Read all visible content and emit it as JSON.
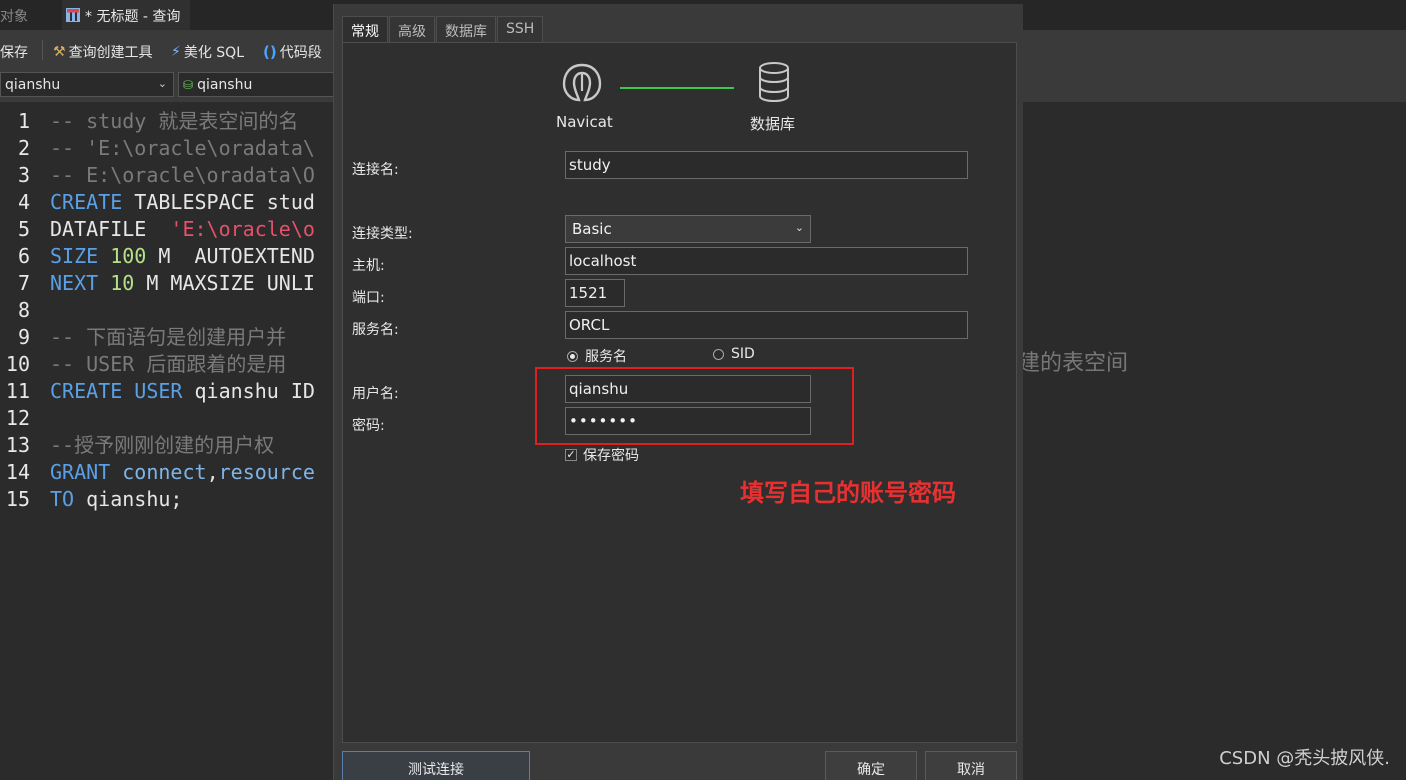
{
  "tabs": {
    "objects": "对象",
    "query": "* 无标题 - 查询"
  },
  "toolbar": {
    "save": "保存",
    "builder": "查询创建工具",
    "beautify": "美化 SQL",
    "snippet": "代码段"
  },
  "selectors": {
    "connection": "qianshu",
    "schema": "qianshu"
  },
  "code": {
    "lines": [
      {
        "n": "1",
        "parts": [
          {
            "c": "cm",
            "t": "-- study 就是表空间的名"
          }
        ]
      },
      {
        "n": "2",
        "parts": [
          {
            "c": "cm",
            "t": "-- 'E:\\oracle\\oradata\\"
          }
        ]
      },
      {
        "n": "3",
        "parts": [
          {
            "c": "cm",
            "t": "-- E:\\oracle\\oradata\\O"
          }
        ]
      },
      {
        "n": "4",
        "parts": [
          {
            "c": "kw",
            "t": "CREATE"
          },
          {
            "c": "pl",
            "t": " TABLESPACE stud"
          }
        ]
      },
      {
        "n": "5",
        "parts": [
          {
            "c": "pl",
            "t": "DATAFILE  "
          },
          {
            "c": "str",
            "t": "'E:\\oracle\\o"
          }
        ]
      },
      {
        "n": "6",
        "parts": [
          {
            "c": "kw",
            "t": "SIZE"
          },
          {
            "c": "pl",
            "t": " "
          },
          {
            "c": "num",
            "t": "100"
          },
          {
            "c": "pl",
            "t": " M  AUTOEXTEND"
          }
        ]
      },
      {
        "n": "7",
        "parts": [
          {
            "c": "kw",
            "t": "NEXT"
          },
          {
            "c": "pl",
            "t": " "
          },
          {
            "c": "num",
            "t": "10"
          },
          {
            "c": "pl",
            "t": " M MAXSIZE UNLI"
          }
        ]
      },
      {
        "n": "8",
        "parts": []
      },
      {
        "n": "9",
        "parts": [
          {
            "c": "cm",
            "t": "-- 下面语句是创建用户并"
          }
        ]
      },
      {
        "n": "10",
        "parts": [
          {
            "c": "cm",
            "t": "-- USER 后面跟着的是用"
          }
        ]
      },
      {
        "n": "11",
        "parts": [
          {
            "c": "kw",
            "t": "CREATE USER"
          },
          {
            "c": "pl",
            "t": " qianshu ID"
          }
        ]
      },
      {
        "n": "12",
        "parts": []
      },
      {
        "n": "13",
        "parts": [
          {
            "c": "cm",
            "t": "--授予刚刚创建的用户权"
          }
        ]
      },
      {
        "n": "14",
        "parts": [
          {
            "c": "kw",
            "t": "GRANT"
          },
          {
            "c": "pl",
            "t": " "
          },
          {
            "c": "fn",
            "t": "connect"
          },
          {
            "c": "pl",
            "t": ","
          },
          {
            "c": "fn",
            "t": "resource"
          }
        ]
      },
      {
        "n": "15",
        "parts": [
          {
            "c": "kw",
            "t": "TO"
          },
          {
            "c": "pl",
            "t": " qianshu;"
          }
        ]
      }
    ],
    "line10_tail": "建的表空间"
  },
  "dialog": {
    "tabs": [
      "常规",
      "高级",
      "数据库",
      "SSH"
    ],
    "diagram": {
      "left_label": "Navicat",
      "right_label": "数据库"
    },
    "labels": {
      "conn_name": "连接名:",
      "conn_type": "连接类型:",
      "host": "主机:",
      "port": "端口:",
      "service": "服务名:",
      "user": "用户名:",
      "password": "密码:"
    },
    "values": {
      "conn_name": "study",
      "conn_type": "Basic",
      "host": "localhost",
      "port": "1521",
      "service": "ORCL",
      "user": "qianshu",
      "password": "•••••••"
    },
    "radio": {
      "service_name": "服务名",
      "sid": "SID",
      "selected": "service_name"
    },
    "save_password": {
      "label": "保存密码",
      "checked": true
    },
    "annotation": "填写自己的账号密码",
    "buttons": {
      "test": "测试连接",
      "ok": "确定",
      "cancel": "取消"
    }
  },
  "watermark": "CSDN @秃头披风侠.",
  "colors": {
    "annotation": "#e02020",
    "connector": "#3cc84a",
    "keyword": "#5aa0e6",
    "string": "#e6506a",
    "number": "#b5e08a"
  }
}
